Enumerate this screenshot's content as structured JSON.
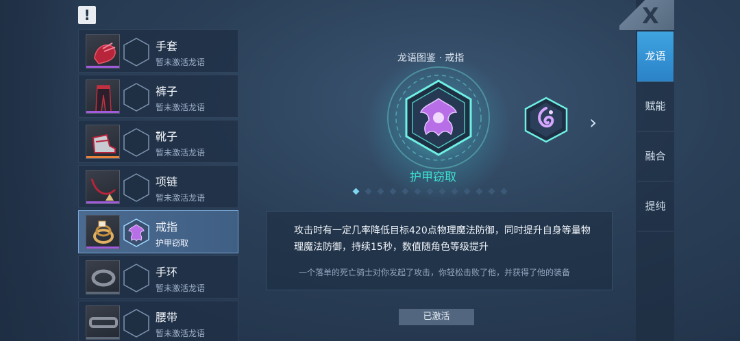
{
  "notice_icon": "!",
  "items": [
    {
      "name": "手套",
      "sub": "暂未激活龙语",
      "rarity_color": "#a15bdc",
      "icon": "glove-icon",
      "selected": false
    },
    {
      "name": "裤子",
      "sub": "暂未激活龙语",
      "rarity_color": "#a15bdc",
      "icon": "pants-icon",
      "selected": false
    },
    {
      "name": "靴子",
      "sub": "暂未激活龙语",
      "rarity_color": "#e8823a",
      "icon": "boots-icon",
      "selected": false
    },
    {
      "name": "项链",
      "sub": "暂未激活龙语",
      "rarity_color": "#a15bdc",
      "icon": "necklace-icon",
      "selected": false
    },
    {
      "name": "戒指",
      "sub": "护甲窃取",
      "rarity_color": "#a15bdc",
      "icon": "ring-icon",
      "selected": true
    },
    {
      "name": "手环",
      "sub": "暂未激活龙语",
      "rarity_color": "#5d6878",
      "icon": "bracelet-icon",
      "selected": false
    },
    {
      "name": "腰带",
      "sub": "暂未激活龙语",
      "rarity_color": "#5d6878",
      "icon": "belt-icon",
      "selected": false
    }
  ],
  "gallery": {
    "title": "龙语图鉴 · 戒指",
    "skill_name": "护甲窃取",
    "page_count": 13,
    "active_page": 1,
    "description": "攻击时有一定几率降低目标420点物理魔法防御，同时提升自身等量物理魔法防御，持续15秒，数值随角色等级提升",
    "flavor": "一个落单的死亡骑士对你发起了攻击，你轻松击败了他，并获得了他的装备",
    "status_button": "已激活"
  },
  "tabs": [
    {
      "label": "龙语",
      "active": true
    },
    {
      "label": "赋能",
      "active": false
    },
    {
      "label": "融合",
      "active": false
    },
    {
      "label": "提纯",
      "active": false
    }
  ],
  "close_icon": "X",
  "next_icon": "›",
  "colors": {
    "accent_cyan": "#3fe3d3",
    "tab_active": "#2b82c8",
    "selected_item": "#4b6a90"
  }
}
